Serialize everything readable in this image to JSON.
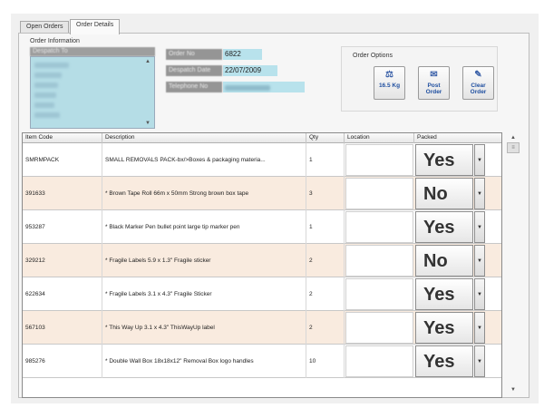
{
  "tabs": [
    {
      "label": "Open Orders"
    },
    {
      "label": "Order Details"
    }
  ],
  "order_info": {
    "group_label": "Order Information",
    "header": "Despatch To"
  },
  "fields": {
    "order_no_label": "Order No",
    "order_no_value": "6822",
    "despatch_date_label": "Despatch Date",
    "despatch_date_value": "22/07/2009",
    "telephone_label": "Telephone No"
  },
  "order_options": {
    "group_label": "Order Options",
    "weight_label": "16.5 Kg",
    "post_label": "Post Order",
    "clear_label": "Clear Order"
  },
  "grid": {
    "headers": {
      "item_code": "Item Code",
      "description": "Description",
      "qty": "Qty",
      "location": "Location",
      "packed": "Packed"
    },
    "rows": [
      {
        "code": "SMRMPACK",
        "description": "SMALL REMOVALS PACK-bx/>Boxes & packaging materia...",
        "qty": "1",
        "packed": "Yes"
      },
      {
        "code": "391633",
        "description": "* Brown Tape Roll 66m x 50mm Strong brown box tape",
        "qty": "3",
        "packed": "No"
      },
      {
        "code": "953287",
        "description": "* Black Marker Pen bullet point large tip marker pen",
        "qty": "1",
        "packed": "Yes"
      },
      {
        "code": "329212",
        "description": "* Fragile Labels 5.9 x 1.3\" Fragile sticker",
        "qty": "2",
        "packed": "No"
      },
      {
        "code": "622634",
        "description": "* Fragile Labels 3.1 x 4.3\" Fragile Sticker",
        "qty": "2",
        "packed": "Yes"
      },
      {
        "code": "567103",
        "description": "* This Way Up 3.1 x 4.3\" ThisWayUp label",
        "qty": "2",
        "packed": "Yes"
      },
      {
        "code": "985276",
        "description": "* Double Wall Box 18x18x12\" Removal Box logo handles",
        "qty": "10",
        "packed": "Yes"
      }
    ]
  },
  "icons": {
    "weight": "scales-icon",
    "post": "post-icon",
    "clear": "broom-icon",
    "dropdown": "chevron-down-icon"
  }
}
